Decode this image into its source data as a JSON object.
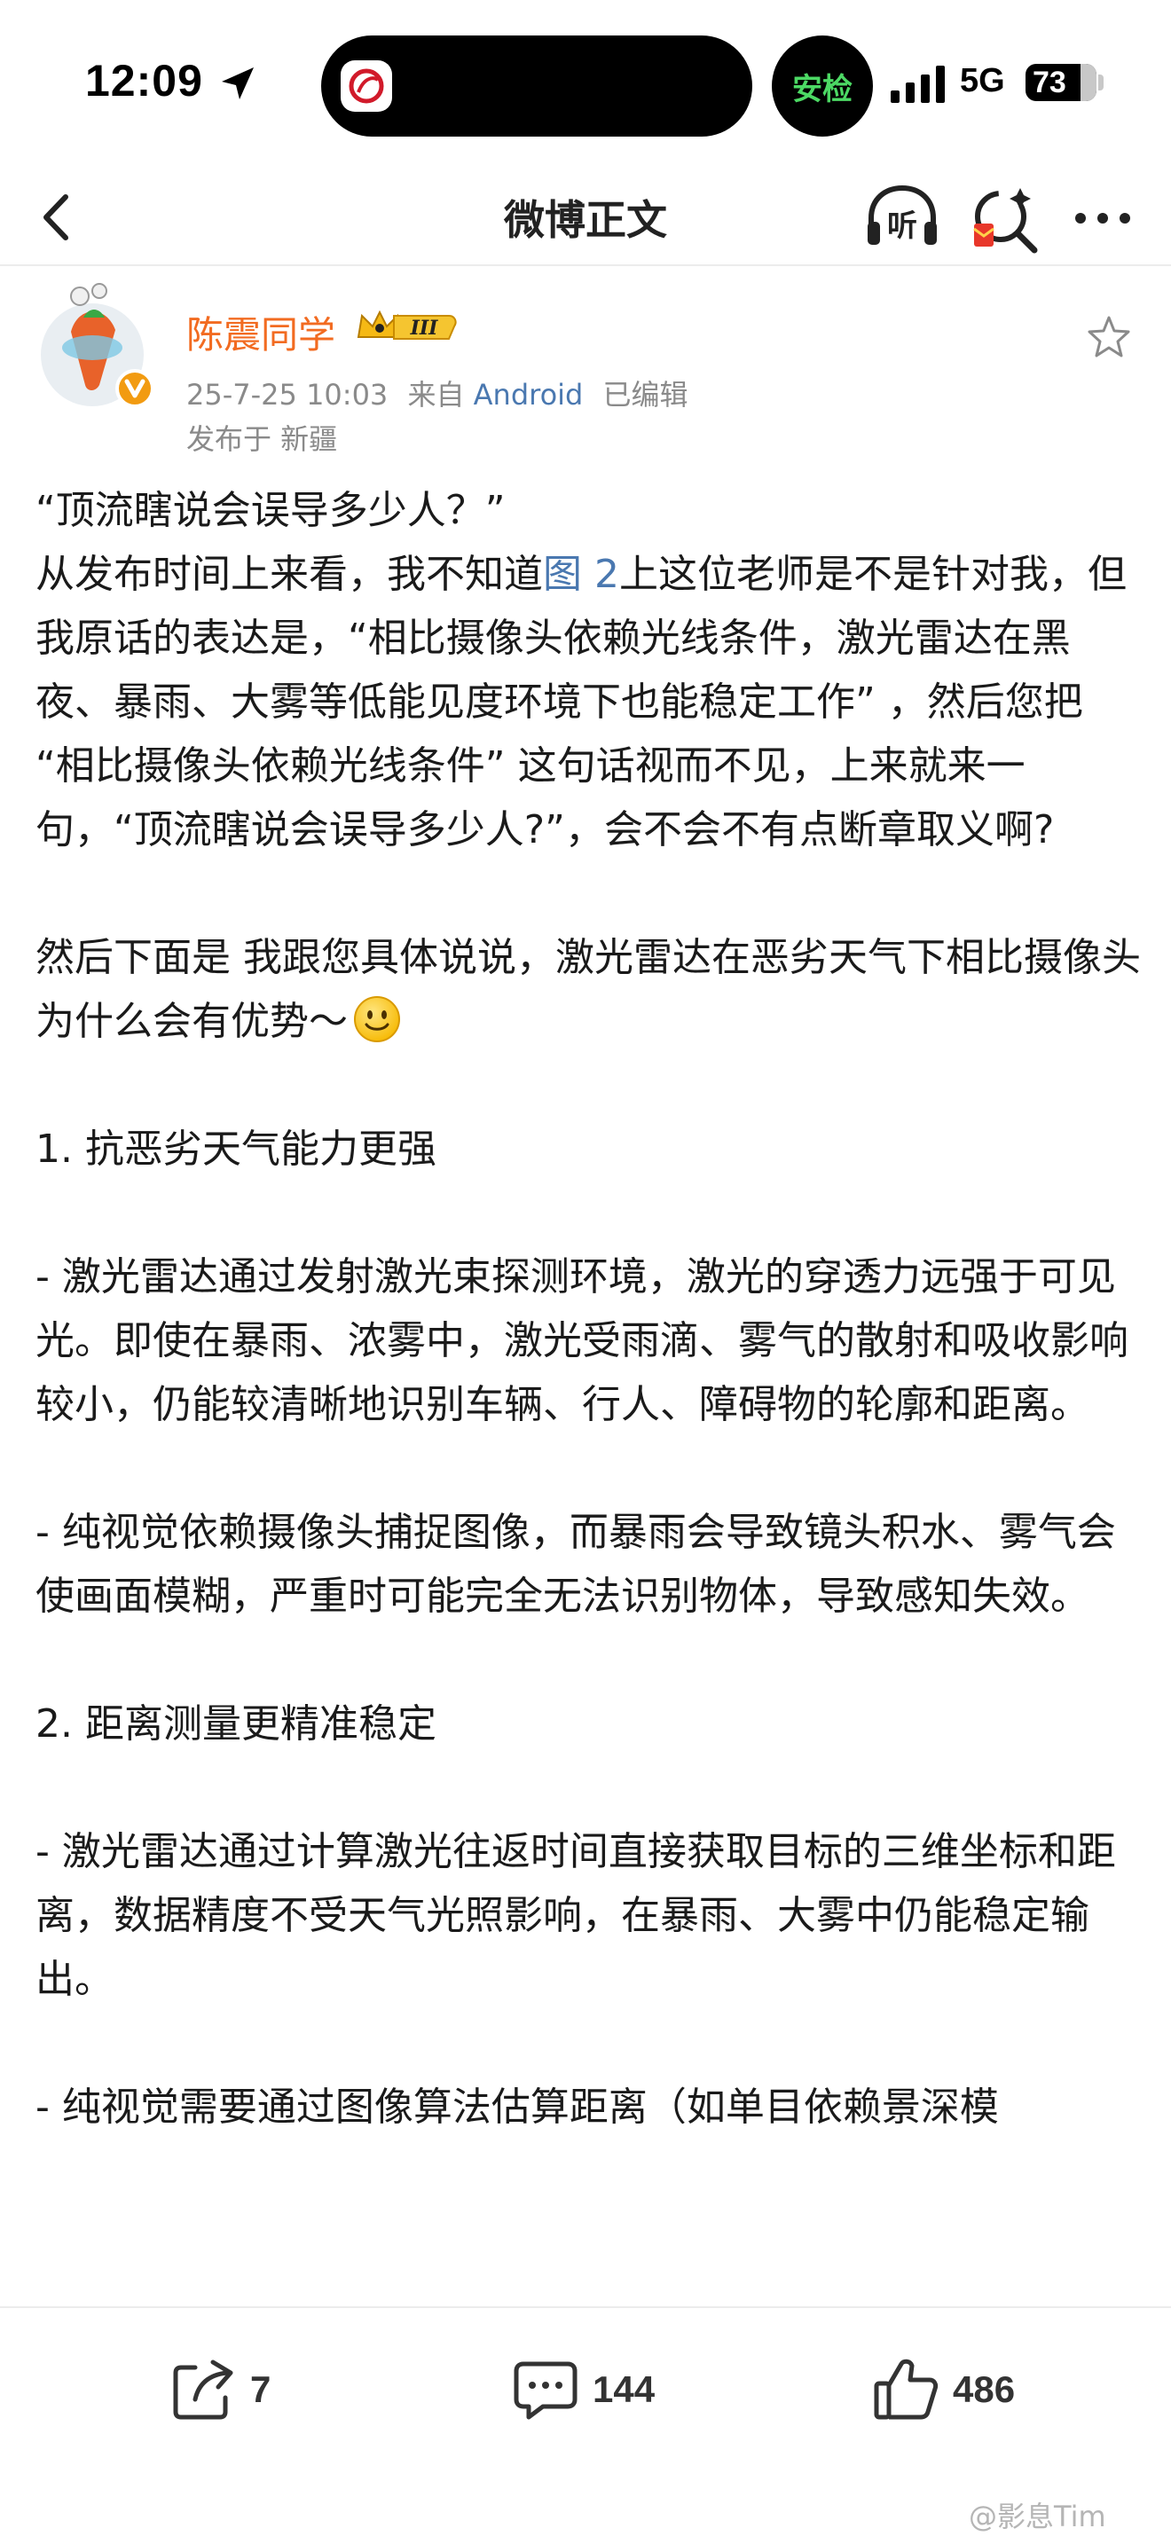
{
  "status_bar": {
    "time": "12:09",
    "safety_label": "安检",
    "network": "5G",
    "battery": "73"
  },
  "nav": {
    "title": "微博正文",
    "listen_label": "听"
  },
  "post": {
    "author": "陈震同学",
    "badge_level": "III",
    "date": "25-7-25 10:03",
    "source_prefix": "来自",
    "source": "Android",
    "edited": "已编辑",
    "location": "发布于 新疆",
    "body": {
      "p1": "“顶流瞎说会误导多少人？”",
      "p2_before": "从发布时间上来看，我不知道",
      "p2_link": "图 2",
      "p2_after": "上这位老师是不是针对我，但我原话的表达是，“相比摄像头依赖光线条件，激光雷达在黑 夜、暴雨、大雾等低能见度环境下也能稳定工作” ，然后您把 “相比摄像头依赖光线条件” 这句话视而不见，上来就来一句，“顶流瞎说会误导多少人?”，会不会不有点断章取义啊?",
      "p3": "然后下面是 我跟您具体说说，激光雷达在恶劣天气下相比摄像头为什么会有优势～",
      "p4": "1. 抗恶劣天气能力更强",
      "p5": "- 激光雷达通过发射激光束探测环境，激光的穿透力远强于可见光。即使在暴雨、浓雾中，激光受雨滴、雾气的散射和吸收影响较小，仍能较清晰地识别车辆、行人、障碍物的轮廓和距离。",
      "p6": "- 纯视觉依赖摄像头捕捉图像，而暴雨会导致镜头积水、雾气会使画面模糊，严重时可能完全无法识别物体，导致感知失效。",
      "p7": "2. 距离测量更精准稳定",
      "p8": "- 激光雷达通过计算激光往返时间直接获取目标的三维坐标和距离，数据精度不受天气光照影响，在暴雨、大雾中仍能稳定输出。",
      "p9": "- 纯视觉需要通过图像算法估算距离（如单目依赖景深模"
    }
  },
  "actions": {
    "reposts": "7",
    "comments": "144",
    "likes": "486"
  },
  "watermark": "@影息Tim",
  "colors": {
    "author_name": "#f26b21",
    "link": "#4a78b0",
    "meta": "#8a8a8a"
  }
}
